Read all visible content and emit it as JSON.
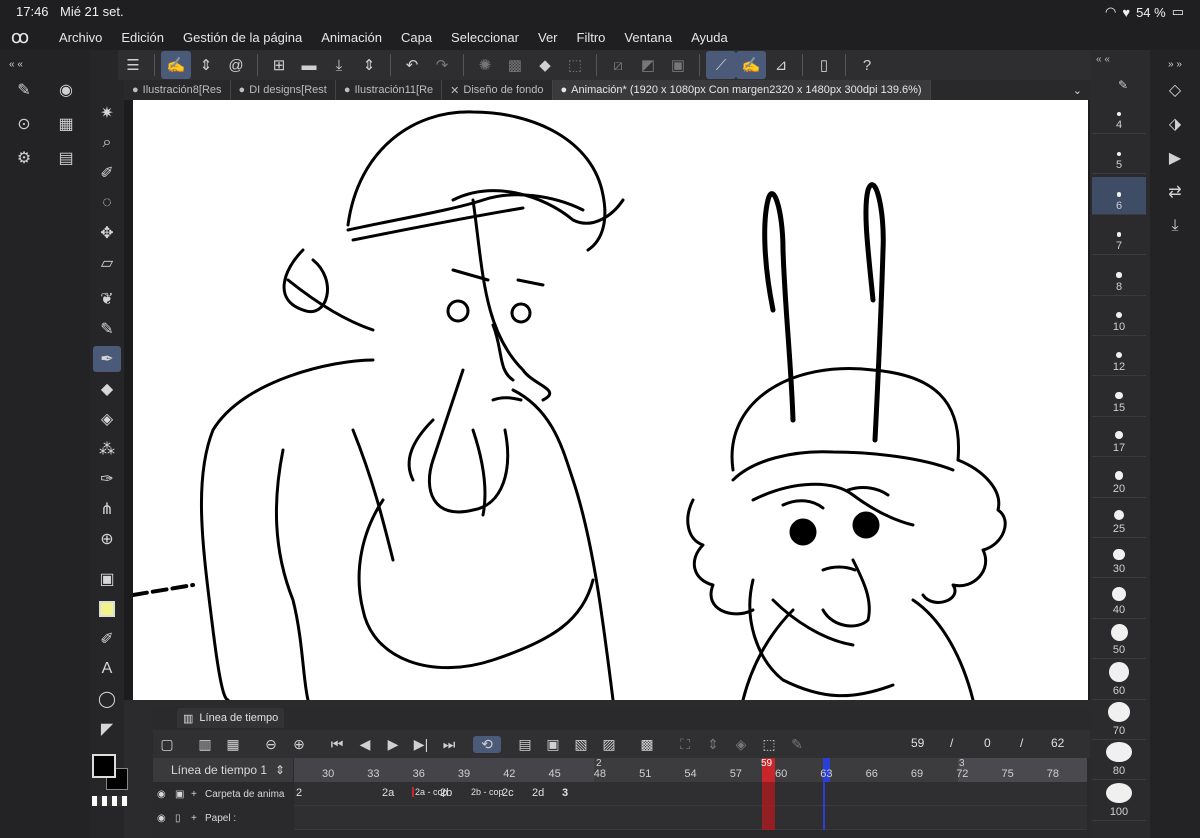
{
  "status_bar": {
    "time": "17:46",
    "date": "Mié 21 set.",
    "battery": "54 %"
  },
  "menu": [
    "Archivo",
    "Edición",
    "Gestión de la página",
    "Animación",
    "Capa",
    "Seleccionar",
    "Ver",
    "Filtro",
    "Ventana",
    "Ayuda"
  ],
  "tabs": [
    {
      "label": "Ilustración8[Res",
      "active": false
    },
    {
      "label": "DI designs[Rest",
      "active": false
    },
    {
      "label": "Ilustración11[Re",
      "active": false
    },
    {
      "label": "Diseño de fondo",
      "active": false
    },
    {
      "label": "Animación* (1920 x 1080px Con margen2320 x 1480px 300dpi 139.6%)",
      "active": true
    }
  ],
  "brush_sizes": [
    "4",
    "5",
    "6",
    "7",
    "8",
    "10",
    "12",
    "15",
    "17",
    "20",
    "25",
    "30",
    "40",
    "50",
    "60",
    "70",
    "80",
    "100"
  ],
  "selected_brush_size": "6",
  "timeline": {
    "title": "Línea de tiempo",
    "name": "Línea de tiempo 1",
    "current_frame": "59",
    "start": "0",
    "end": "62",
    "ruler_ticks": [
      "30",
      "33",
      "36",
      "39",
      "42",
      "45",
      "48",
      "51",
      "54",
      "57",
      "60",
      "63",
      "66",
      "69",
      "72",
      "75",
      "78"
    ],
    "ruler_markers": {
      "m2": "2",
      "m3": "3",
      "playhead": "59"
    },
    "rows": [
      {
        "name": "Carpeta de anima",
        "cells": [
          "2",
          "2a",
          "2a - cop",
          "2b",
          "2b - cop",
          "2c",
          "2d",
          "3"
        ]
      },
      {
        "name": "Papel :",
        "cells": []
      }
    ]
  },
  "colors": {
    "accent": "#4a5a78",
    "playhead": "#c8262b",
    "marker_blue": "#2a3fd8"
  }
}
